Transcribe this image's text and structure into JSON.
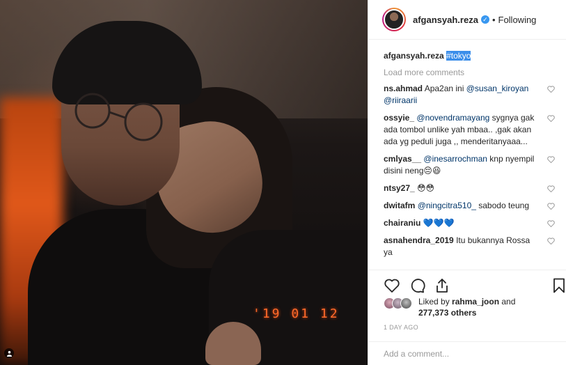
{
  "photo": {
    "datestamp": "'19 01 12"
  },
  "header": {
    "username": "afgansyah.reza",
    "separator": "•",
    "follow_status": "Following"
  },
  "caption": {
    "username": "afgansyah.reza",
    "hashtag": "#tokyo"
  },
  "load_more": "Load more comments",
  "comments": [
    {
      "user": "ns.ahmad",
      "text": "Apa2an ini ",
      "mentions": "@susan_kiroyan @riiraarii"
    },
    {
      "user": "ossyie_",
      "mention": "@novendramayang",
      "text": " sygnya gak ada tombol unlike yah mbaa.. ,gak akan ada yg peduli juga ,, menderitanyaaa..."
    },
    {
      "user": "cmlyas__",
      "mention": "@inesarrochman",
      "text": " knp nyempil disini neng😔😆"
    },
    {
      "user": "ntsy27_",
      "text": "😳😳"
    },
    {
      "user": "dwitafm",
      "mention": "@ningcitra510_",
      "text": " sabodo teung"
    },
    {
      "user": "chairaniu",
      "text": "💙💙💙"
    },
    {
      "user": "asnahendra_2019",
      "text": "Itu bukannya Rossa ya"
    }
  ],
  "likes": {
    "prefix": "Liked by ",
    "user": "rahma_joon",
    "suffix": " and",
    "count": "277,373 others"
  },
  "time_ago": "1 DAY AGO",
  "add_comment": {
    "placeholder": "Add a comment..."
  },
  "icons": [
    "heart-icon",
    "comment-icon",
    "share-icon",
    "bookmark-icon",
    "verified-icon",
    "user-tag-icon"
  ],
  "colors": {
    "verified": "#3897f0",
    "datestamp": "#ff6a2a",
    "mention": "#003569",
    "hashtag_highlight": "#3b8eea"
  }
}
